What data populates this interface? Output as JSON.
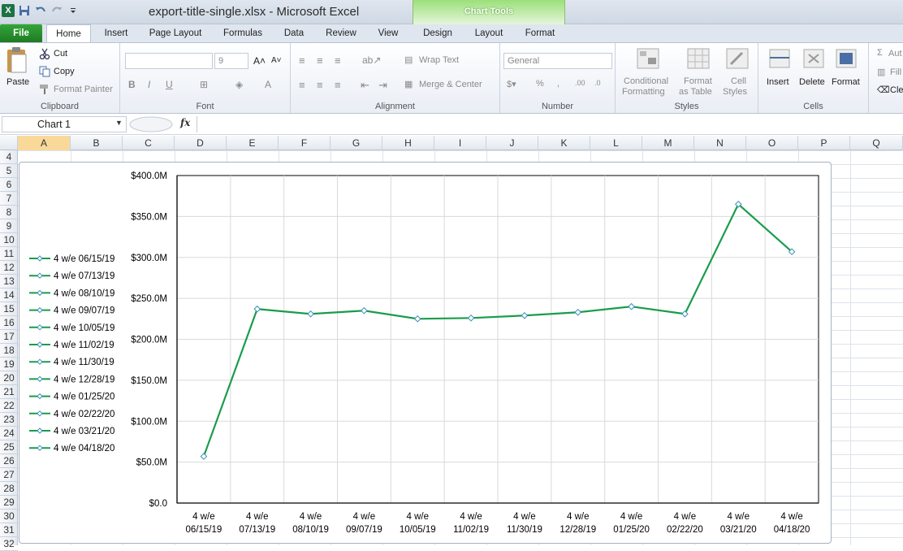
{
  "window": {
    "title": "export-title-single.xlsx - Microsoft Excel",
    "chart_tools_label": "Chart Tools"
  },
  "tabs": [
    "File",
    "Home",
    "Insert",
    "Page Layout",
    "Formulas",
    "Data",
    "Review",
    "View",
    "Design",
    "Layout",
    "Format"
  ],
  "ribbon": {
    "clipboard": {
      "paste": "Paste",
      "cut": "Cut",
      "copy": "Copy",
      "format_painter": "Format Painter",
      "label": "Clipboard"
    },
    "font": {
      "size": "9",
      "label": "Font"
    },
    "alignment": {
      "wrap_text": "Wrap Text",
      "merge_center": "Merge & Center",
      "label": "Alignment"
    },
    "number": {
      "format": "General",
      "percent": "%",
      "comma": ",",
      "label": "Number"
    },
    "styles": {
      "conditional_1": "Conditional",
      "conditional_2": "Formatting",
      "format_as_1": "Format",
      "format_as_2": "as Table",
      "cell_styles_1": "Cell",
      "cell_styles_2": "Styles",
      "label": "Styles"
    },
    "cells": {
      "insert": "Insert",
      "delete": "Delete",
      "format": "Format",
      "label": "Cells"
    },
    "editing": {
      "autosum": "Aut",
      "fill": "Fill",
      "clear": "Cle"
    }
  },
  "formula_bar": {
    "name_box": "Chart 1",
    "fx": "fx",
    "formula": ""
  },
  "columns": [
    "A",
    "B",
    "C",
    "D",
    "E",
    "F",
    "G",
    "H",
    "I",
    "J",
    "K",
    "L",
    "M",
    "N",
    "O",
    "P",
    "Q"
  ],
  "rows": [
    "4",
    "5",
    "6",
    "7",
    "8",
    "9",
    "10",
    "11",
    "12",
    "13",
    "14",
    "15",
    "16",
    "17",
    "18",
    "19",
    "20",
    "21",
    "22",
    "23",
    "24",
    "25",
    "26",
    "27",
    "28",
    "29",
    "30",
    "31",
    "32"
  ],
  "colors": {
    "series": "#1a9c4c",
    "marker": "#3a8fb7",
    "accent_green": "#1e7a24"
  },
  "chart_data": {
    "type": "line",
    "categories": [
      "4 w/e 06/15/19",
      "4 w/e 07/13/19",
      "4 w/e 08/10/19",
      "4 w/e 09/07/19",
      "4 w/e 10/05/19",
      "4 w/e 11/02/19",
      "4 w/e 11/30/19",
      "4 w/e 12/28/19",
      "4 w/e 01/25/20",
      "4 w/e 02/22/20",
      "4 w/e 03/21/20",
      "4 w/e 04/18/20"
    ],
    "category_lines": [
      [
        "4 w/e",
        "06/15/19"
      ],
      [
        "4 w/e",
        "07/13/19"
      ],
      [
        "4 w/e",
        "08/10/19"
      ],
      [
        "4 w/e",
        "09/07/19"
      ],
      [
        "4 w/e",
        "10/05/19"
      ],
      [
        "4 w/e",
        "11/02/19"
      ],
      [
        "4 w/e",
        "11/30/19"
      ],
      [
        "4 w/e",
        "12/28/19"
      ],
      [
        "4 w/e",
        "01/25/20"
      ],
      [
        "4 w/e",
        "02/22/20"
      ],
      [
        "4 w/e",
        "03/21/20"
      ],
      [
        "4 w/e",
        "04/18/20"
      ]
    ],
    "series": [
      {
        "values": [
          57,
          237,
          231,
          235,
          225,
          226,
          229,
          233,
          240,
          231,
          365,
          307
        ]
      }
    ],
    "legend": [
      "4 w/e 06/15/19",
      "4 w/e 07/13/19",
      "4 w/e 08/10/19",
      "4 w/e 09/07/19",
      "4 w/e 10/05/19",
      "4 w/e 11/02/19",
      "4 w/e 11/30/19",
      "4 w/e 12/28/19",
      "4 w/e 01/25/20",
      "4 w/e 02/22/20",
      "4 w/e 03/21/20",
      "4 w/e 04/18/20"
    ],
    "legend_position": "left",
    "y_ticks": [
      "$0.0",
      "$50.0M",
      "$100.0M",
      "$150.0M",
      "$200.0M",
      "$250.0M",
      "$300.0M",
      "$350.0M",
      "$400.0M"
    ],
    "ylim": [
      0,
      400
    ],
    "y_unit": "M",
    "grid": true,
    "title": "",
    "xlabel": "",
    "ylabel": ""
  }
}
